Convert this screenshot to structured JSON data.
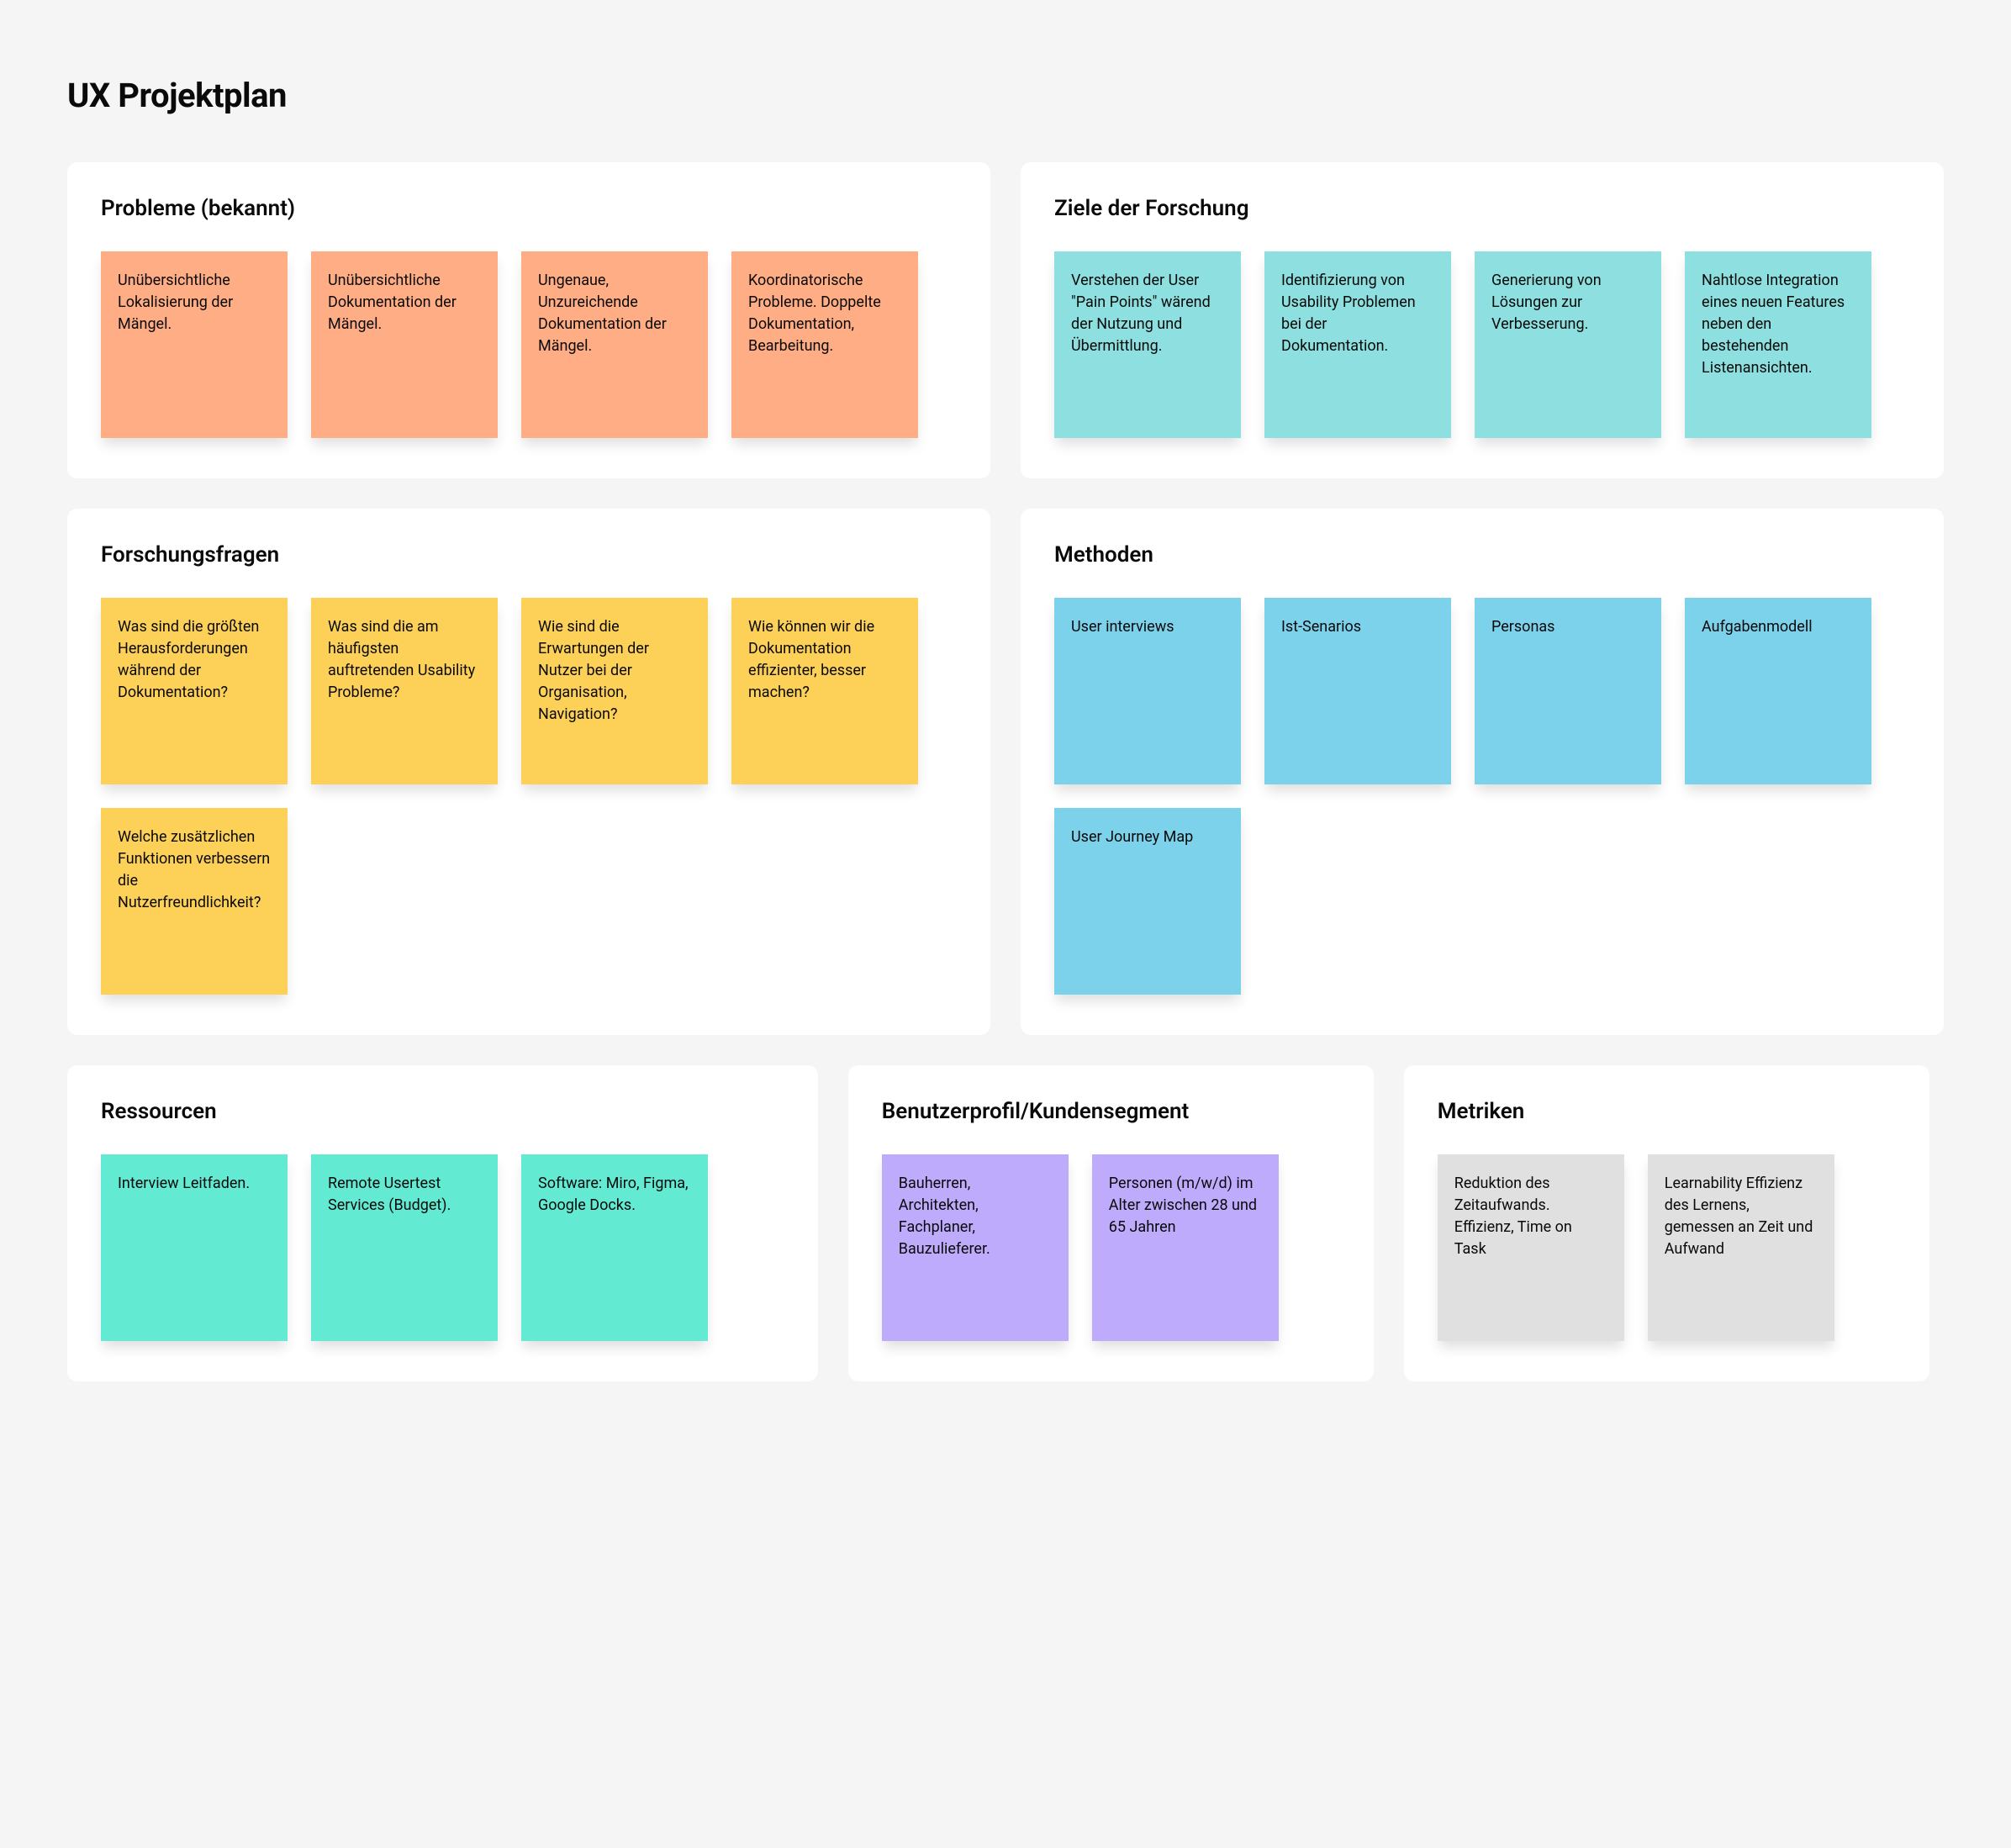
{
  "title": "UX Projektplan",
  "panels": {
    "problems": {
      "title": "Probleme (bekannt)",
      "color": "orange",
      "notes": [
        "Unübersichtliche Lokalisierung der Mängel.",
        "Unübersichtliche Dokumentation der Mängel.",
        "Ungenaue, Unzureichende Dokumentation der Mängel.",
        "Koordinatorische Probleme. Doppelte Dokumentation, Bearbeitung."
      ]
    },
    "goals": {
      "title": "Ziele der Forschung",
      "color": "teal",
      "notes": [
        "Verstehen der User \"Pain Points\" wärend der Nutzung und Übermittlung.",
        "Identifizierung von Usability Problemen bei der Dokumentation.",
        "Generierung von Lösungen zur Verbesserung.",
        "Nahtlose Integration eines neuen Features neben den bestehenden Listenansichten."
      ]
    },
    "questions": {
      "title": "Forschungsfragen",
      "color": "yellow",
      "notes": [
        "Was sind die größten Herausforderungen während der Dokumentation?",
        "Was sind die am häufigsten auftretenden Usability Probleme?",
        "Wie sind die Erwartungen der Nutzer bei der Organisation, Navigation?",
        "Wie können wir die Dokumentation effizienter, besser machen?",
        "Welche zusätzlichen Funktionen verbessern die Nutzerfreundlichkeit?"
      ]
    },
    "methods": {
      "title": "Methoden",
      "color": "sky",
      "notes": [
        "User interviews",
        "Ist-Senarios",
        "Personas",
        "Aufgabenmodell",
        "User Journey Map"
      ]
    },
    "resources": {
      "title": "Ressourcen",
      "color": "mint",
      "notes": [
        "Interview Leitfaden.",
        "Remote Usertest Services (Budget).",
        "Software: Miro, Figma, Google Docks."
      ]
    },
    "profile": {
      "title": "Benutzerprofil/Kundensegment",
      "color": "purple",
      "notes": [
        "Bauherren, Architekten, Fachplaner, Bauzulieferer.",
        "Personen (m/w/d) im Alter zwischen 28 und 65 Jahren"
      ]
    },
    "metrics": {
      "title": "Metriken",
      "color": "gray",
      "notes": [
        "Reduktion des Zeitaufwands. Effizienz, Time on Task",
        "Learnability Effizienz des Lernens, gemessen an Zeit und Aufwand"
      ]
    }
  }
}
